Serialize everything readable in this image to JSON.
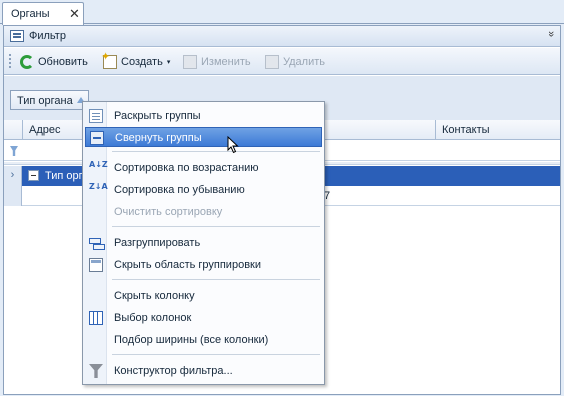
{
  "tab": {
    "label": "Органы",
    "close": "✕"
  },
  "filter_bar": {
    "label": "Фильтр",
    "collapse_glyph": "»"
  },
  "toolbar": {
    "refresh": "Обновить",
    "create": "Создать",
    "create_arrow": "▾",
    "edit": "Изменить",
    "delete": "Удалить"
  },
  "group_area": {
    "tag_label": "Тип органа"
  },
  "grid": {
    "columns": [
      "Адрес",
      "Контакты"
    ],
    "group_row_label": "Тип орг",
    "row_indicator": "›",
    "partial_cell_text": "7"
  },
  "context_menu": {
    "items": [
      {
        "label": "Раскрыть группы",
        "icon": "expand-groups-icon",
        "enabled": true
      },
      {
        "label": "Свернуть группы",
        "icon": "collapse-groups-icon",
        "enabled": true,
        "highlighted": true
      },
      {
        "label": "Сортировка по возрастанию",
        "icon": "sort-ascending-icon",
        "enabled": true
      },
      {
        "label": "Сортировка по убыванию",
        "icon": "sort-descending-icon",
        "enabled": true
      },
      {
        "label": "Очистить сортировку",
        "icon": "",
        "enabled": false
      },
      {
        "label": "Разгруппировать",
        "icon": "ungroup-icon",
        "enabled": true
      },
      {
        "label": "Скрыть область группировки",
        "icon": "hide-group-panel-icon",
        "enabled": true
      },
      {
        "label": "Скрыть колонку",
        "icon": "",
        "enabled": true
      },
      {
        "label": "Выбор колонок",
        "icon": "column-chooser-icon",
        "enabled": true
      },
      {
        "label": "Подбор ширины (все колонки)",
        "icon": "",
        "enabled": true
      },
      {
        "label": "Конструктор фильтра...",
        "icon": "filter-editor-icon",
        "enabled": true
      }
    ]
  },
  "sort_icons": {
    "asc": "A↓Z",
    "desc": "Z↓A"
  }
}
